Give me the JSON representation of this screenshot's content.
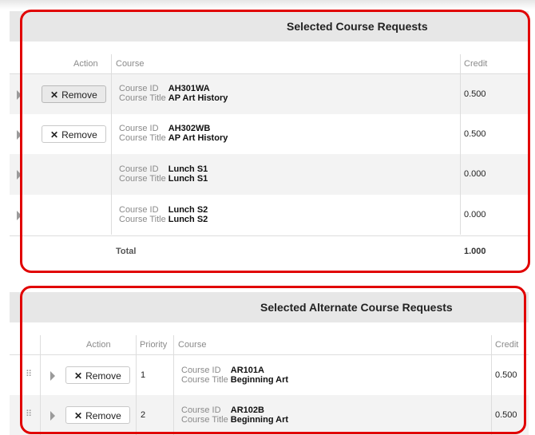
{
  "selected": {
    "title": "Selected Course Requests",
    "headers": {
      "action": "Action",
      "course": "Course",
      "credit": "Credit"
    },
    "rows": [
      {
        "remove_label": "Remove",
        "id_label": "Course ID",
        "id": "AH301WA",
        "title_label": "Course Title",
        "title": "AP Art History",
        "credit": "0.500"
      },
      {
        "remove_label": "Remove",
        "id_label": "Course ID",
        "id": "AH302WB",
        "title_label": "Course Title",
        "title": "AP Art History",
        "credit": "0.500"
      },
      {
        "id_label": "Course ID",
        "id": "Lunch S1",
        "title_label": "Course Title",
        "title": "Lunch S1",
        "credit": "0.000"
      },
      {
        "id_label": "Course ID",
        "id": "Lunch S2",
        "title_label": "Course Title",
        "title": "Lunch S2",
        "credit": "0.000"
      }
    ],
    "total_label": "Total",
    "total_value": "1.000"
  },
  "alternate": {
    "title": "Selected Alternate Course Requests",
    "headers": {
      "action": "Action",
      "priority": "Priority",
      "course": "Course",
      "credit": "Credit"
    },
    "rows": [
      {
        "remove_label": "Remove",
        "priority": "1",
        "id_label": "Course ID",
        "id": "AR101A",
        "title_label": "Course Title",
        "title": "Beginning Art",
        "credit": "0.500"
      },
      {
        "remove_label": "Remove",
        "priority": "2",
        "id_label": "Course ID",
        "id": "AR102B",
        "title_label": "Course Title",
        "title": "Beginning Art",
        "credit": "0.500"
      }
    ]
  },
  "colors": {
    "highlight": "#e10000",
    "header_bg": "#e7e7e7",
    "row_alt": "#f3f3f3"
  }
}
